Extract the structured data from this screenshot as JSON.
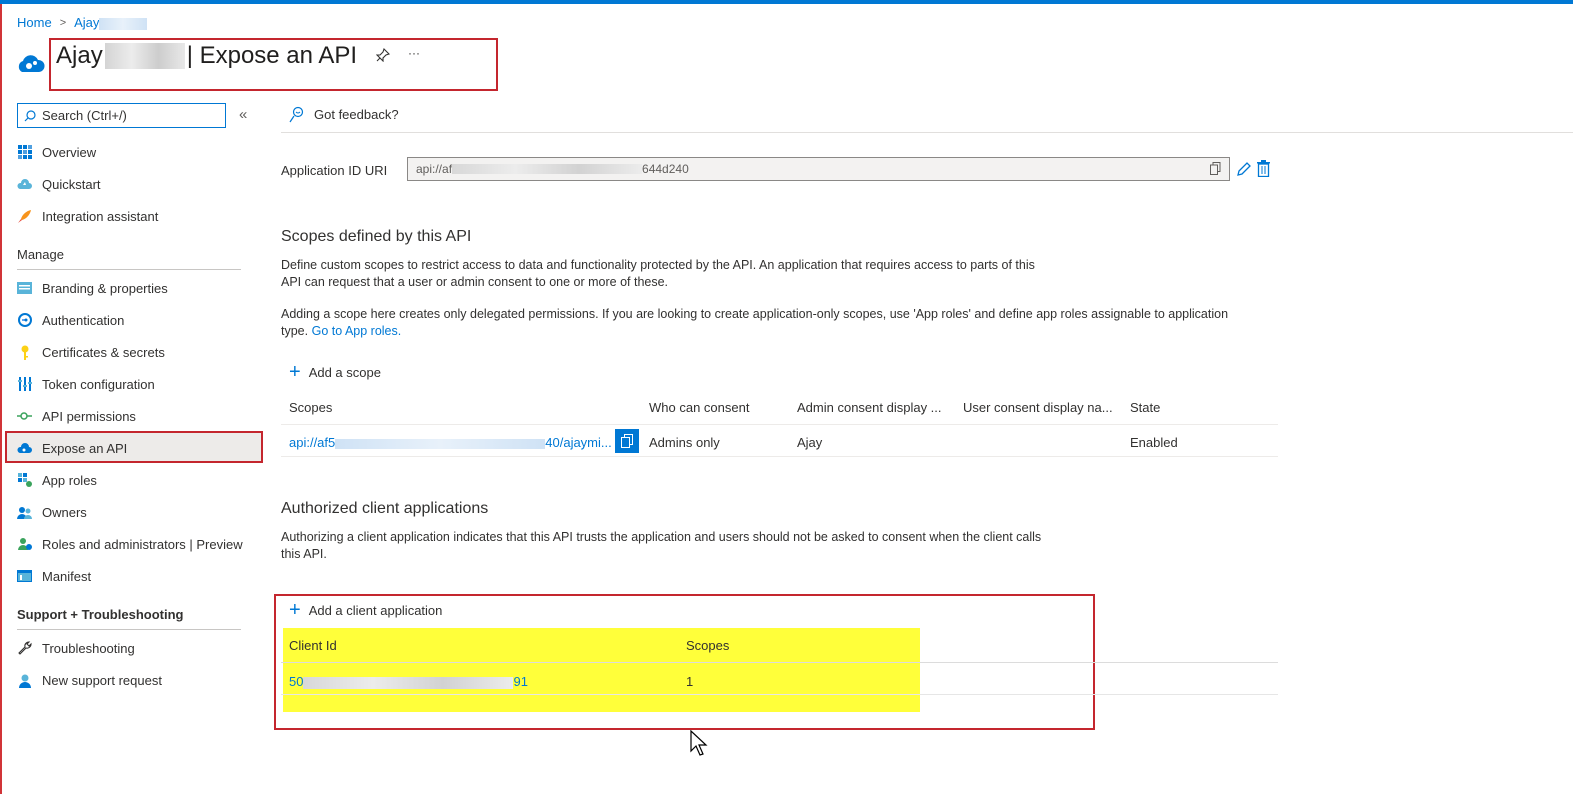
{
  "breadcrumb": {
    "home": "Home",
    "current": "Ajay"
  },
  "header": {
    "title_prefix": "Ajay",
    "title_suffix": "| Expose an API",
    "pin_icon": "pin-icon",
    "more_label": "···"
  },
  "sidebar": {
    "search_placeholder": "Search (Ctrl+/)",
    "collapse_label": "«",
    "items_top": [
      {
        "label": "Overview",
        "icon": "grid-icon"
      },
      {
        "label": "Quickstart",
        "icon": "cloud-icon"
      },
      {
        "label": "Integration assistant",
        "icon": "rocket-icon"
      }
    ],
    "manage_heading": "Manage",
    "manage_items": [
      {
        "label": "Branding & properties",
        "icon": "branding-icon"
      },
      {
        "label": "Authentication",
        "icon": "auth-icon"
      },
      {
        "label": "Certificates & secrets",
        "icon": "key-icon"
      },
      {
        "label": "Token configuration",
        "icon": "token-icon"
      },
      {
        "label": "API permissions",
        "icon": "api-permissions-icon"
      },
      {
        "label": "Expose an API",
        "icon": "cloud-api-icon"
      },
      {
        "label": "App roles",
        "icon": "app-roles-icon"
      },
      {
        "label": "Owners",
        "icon": "owners-icon"
      },
      {
        "label": "Roles and administrators | Preview",
        "icon": "roles-icon"
      },
      {
        "label": "Manifest",
        "icon": "manifest-icon"
      }
    ],
    "support_heading": "Support + Troubleshooting",
    "support_items": [
      {
        "label": "Troubleshooting",
        "icon": "wrench-icon"
      },
      {
        "label": "New support request",
        "icon": "support-icon"
      }
    ]
  },
  "command_bar": {
    "feedback": "Got feedback?"
  },
  "app_id_uri": {
    "label": "Application ID URI",
    "value_start": "api://af",
    "value_end": "644d240"
  },
  "scopes_section": {
    "heading": "Scopes defined by this API",
    "desc1": "Define custom scopes to restrict access to data and functionality protected by the API. An application that requires access to parts of this",
    "desc2": "API can request that a user or admin consent to one or more of these.",
    "desc3": "Adding a scope here creates only delegated permissions. If you are looking to create application-only scopes, use 'App roles' and define app roles assignable to application",
    "desc4_prefix": "type.",
    "desc4_link": "Go to App roles.",
    "add_label": "Add a scope",
    "columns": [
      "Scopes",
      "Who can consent",
      "Admin consent display ...",
      "User consent display na...",
      "State"
    ],
    "row": {
      "scope_start": "api://af5",
      "scope_end": "40/ajaymi...",
      "who": "Admins only",
      "admin_display": "Ajay",
      "user_display": "",
      "state": "Enabled"
    }
  },
  "clients_section": {
    "heading": "Authorized client applications",
    "desc1": "Authorizing a client application indicates that this API trusts the application and users should not be asked to consent when the client calls",
    "desc2": "this API.",
    "add_label": "Add a client application",
    "columns": [
      "Client Id",
      "Scopes"
    ],
    "row": {
      "client_start": "50",
      "client_end": "91",
      "scopes": "1"
    }
  },
  "colors": {
    "accent": "#0078d4",
    "highlight_border": "#c4262e",
    "highlight_fill": "#ffff3a"
  }
}
